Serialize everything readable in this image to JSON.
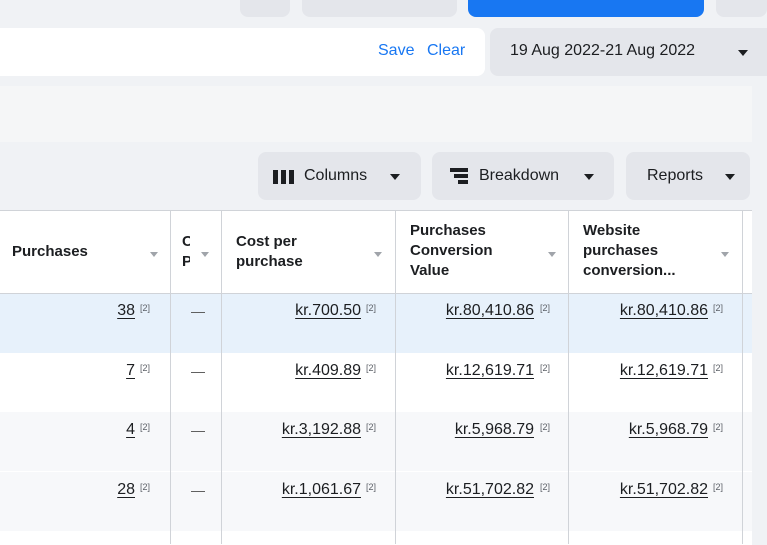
{
  "filters": {
    "save": "Save",
    "clear": "Clear",
    "date_range": "19 Aug 2022-21 Aug 2022"
  },
  "toolbar": {
    "columns": "Columns",
    "breakdown": "Breakdown",
    "reports": "Reports"
  },
  "table": {
    "headers": {
      "purchases": "Purchases",
      "collapsed": "C P",
      "cost_per_purchase": [
        "Cost per",
        "purchase"
      ],
      "purchases_conversion_value": [
        "Purchases",
        "Conversion",
        "Value"
      ],
      "website_purchases_conversion": [
        "Website",
        "purchases",
        "conversion..."
      ]
    },
    "note_icon": "[2]",
    "dash": "—",
    "rows": [
      {
        "purchases": "38",
        "cost": "kr.700.50",
        "value": "kr.80,410.86",
        "website": "kr.80,410.86"
      },
      {
        "purchases": "7",
        "cost": "kr.409.89",
        "value": "kr.12,619.71",
        "website": "kr.12,619.71"
      },
      {
        "purchases": "4",
        "cost": "kr.3,192.88",
        "value": "kr.5,968.79",
        "website": "kr.5,968.79"
      },
      {
        "purchases": "28",
        "cost": "kr.1,061.67",
        "value": "kr.51,702.82",
        "website": "kr.51,702.82"
      }
    ]
  },
  "colors": {
    "accent": "#1877f2",
    "selected_row": "#e7f1fb"
  }
}
